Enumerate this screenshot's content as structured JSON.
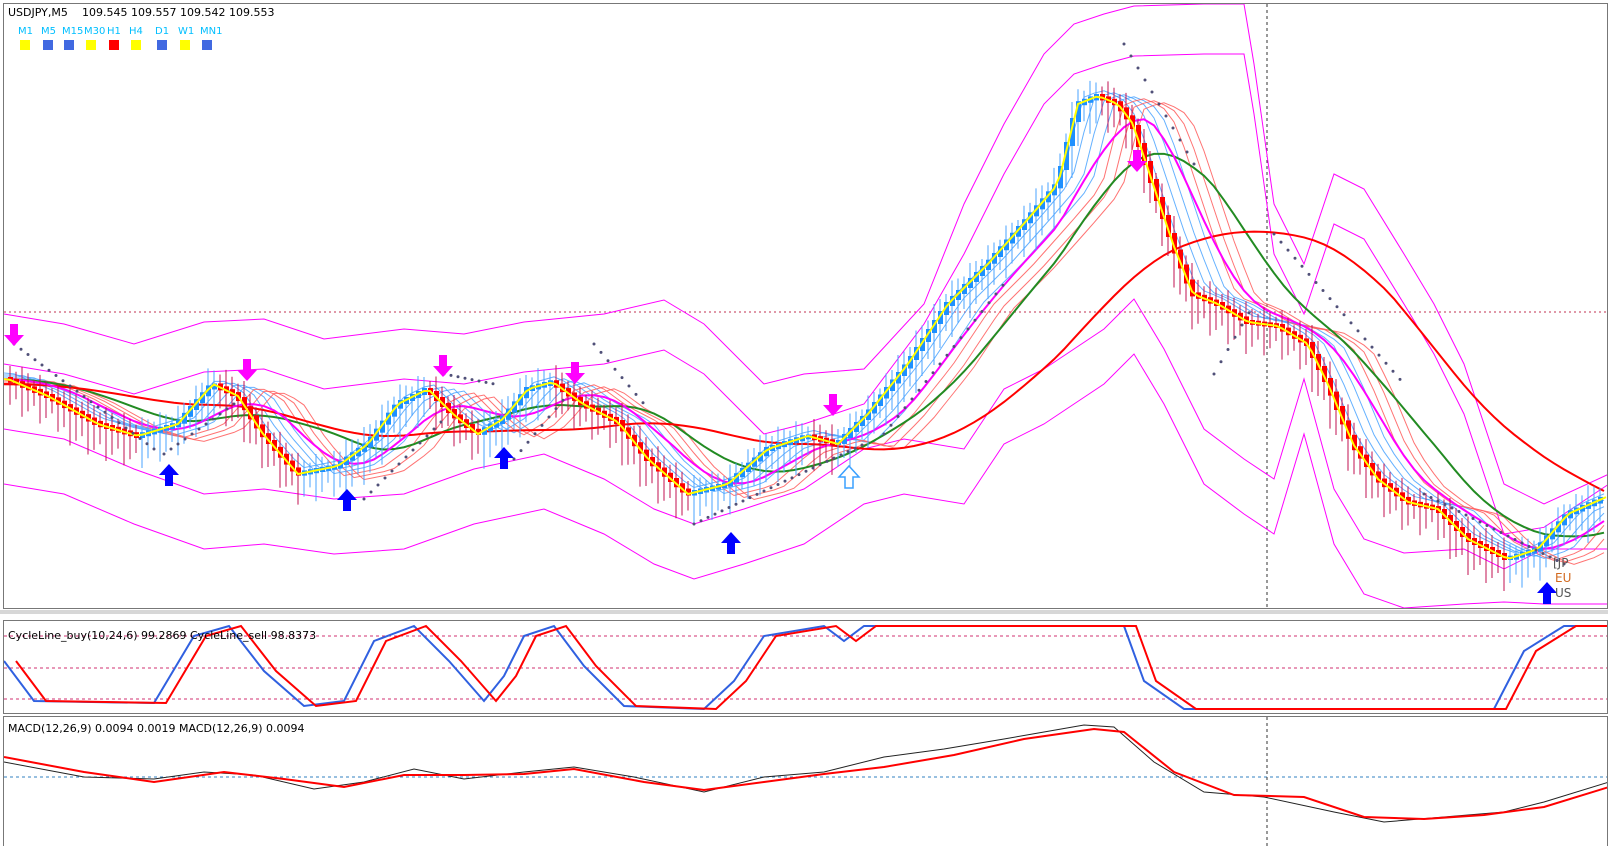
{
  "header": {
    "symbol_tf": "USDJPY,M5",
    "ohlc": "109.545 109.557 109.542 109.553"
  },
  "timeframes": [
    {
      "label": "M1",
      "color": "#ffff00"
    },
    {
      "label": "M5",
      "color": "#4169e1"
    },
    {
      "label": "M15",
      "color": "#4169e1"
    },
    {
      "label": "M30",
      "color": "#ffff00"
    },
    {
      "label": "H1",
      "color": "#ff0000"
    },
    {
      "label": "H4",
      "color": "#ffff00"
    },
    {
      "label": "D1",
      "color": "#4169e1"
    },
    {
      "label": "W1",
      "color": "#ffff00"
    },
    {
      "label": "MN1",
      "color": "#4169e1"
    }
  ],
  "side_labels": [
    "[JP",
    "EU",
    "US"
  ],
  "cycle": {
    "label": "CycleLine_buy(10,24,6) 99.2869  CycleLine_sell 98.8373"
  },
  "macd": {
    "label": "MACD(12,26,9) 0.0094 0.0019  MACD(12,26,9) 0.0094"
  },
  "colors": {
    "bull": "#1e90ff",
    "bear": "#ff0000",
    "band": "#ff00ff",
    "ma_green": "#228b22",
    "ma_red": "#ff0000",
    "arrow_up": "#0000ff",
    "arrow_down": "#ff00ff"
  }
}
